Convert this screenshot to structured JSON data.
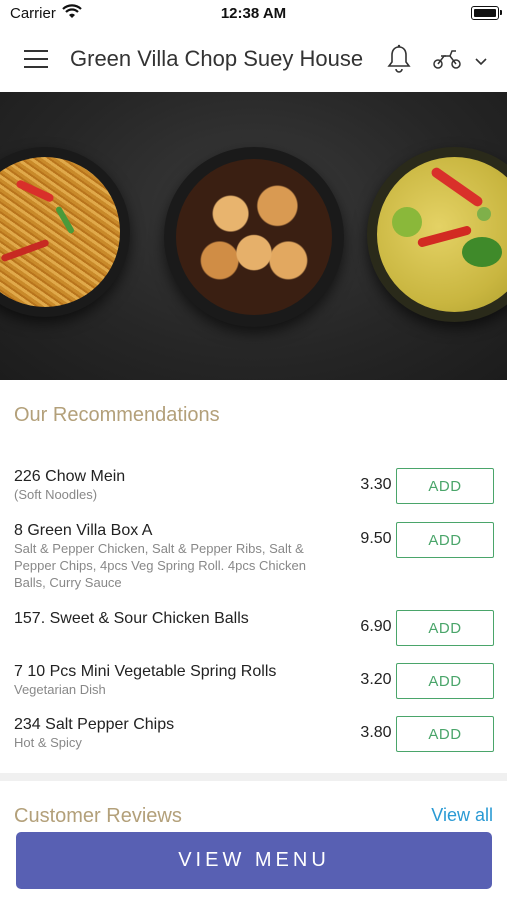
{
  "status_bar": {
    "carrier": "Carrier",
    "time": "12:38 AM"
  },
  "header": {
    "title": "Green Villa Chop Suey House"
  },
  "recommendations": {
    "title": "Our Recommendations",
    "add_label": "ADD",
    "items": [
      {
        "name": "226 Chow Mein",
        "desc": "(Soft Noodles)",
        "price": "3.30"
      },
      {
        "name": "8 Green Villa Box A",
        "desc": "Salt & Pepper Chicken, Salt & Pepper Ribs, Salt & Pepper Chips, 4pcs Veg Spring Roll. 4pcs Chicken Balls, Curry Sauce",
        "price": "9.50"
      },
      {
        "name": "157. Sweet & Sour Chicken Balls",
        "desc": "",
        "price": "6.90"
      },
      {
        "name": "7 10 Pcs Mini Vegetable Spring Rolls",
        "desc": "Vegetarian Dish",
        "price": "3.20"
      },
      {
        "name": "234 Salt Pepper Chips",
        "desc": "Hot & Spicy",
        "price": "3.80"
      }
    ]
  },
  "reviews": {
    "title": "Customer Reviews",
    "view_all": "View all"
  },
  "footer": {
    "view_menu": "VIEW MENU"
  },
  "colors": {
    "accent_gold": "#b3a07a",
    "add_green": "#4aa56a",
    "link_blue": "#2a9ad4",
    "primary_button": "#5860b3"
  }
}
